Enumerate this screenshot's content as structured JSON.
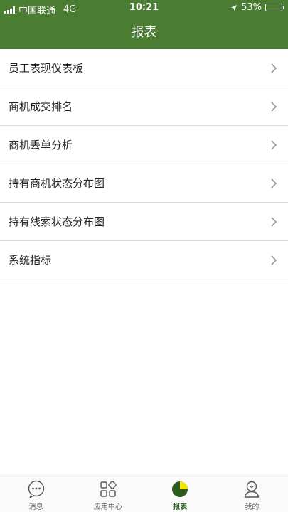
{
  "status_bar": {
    "carrier": "中国联通",
    "network": "4G",
    "time": "10:21",
    "battery_percent": "53%",
    "battery_level": 0.53
  },
  "header": {
    "title": "报表"
  },
  "report_list": [
    {
      "label": "员工表现仪表板"
    },
    {
      "label": "商机成交排名"
    },
    {
      "label": "商机丢单分析"
    },
    {
      "label": "持有商机状态分布图"
    },
    {
      "label": "持有线索状态分布图"
    },
    {
      "label": "系统指标"
    }
  ],
  "tab_bar": {
    "tabs": [
      {
        "label": "消息",
        "icon": "chat-bubble-icon"
      },
      {
        "label": "应用中心",
        "icon": "app-grid-icon"
      },
      {
        "label": "报表",
        "icon": "pie-chart-icon",
        "active": true
      },
      {
        "label": "我的",
        "icon": "person-icon"
      }
    ]
  },
  "colors": {
    "primary": "#4a7c32",
    "active_tab": "#2d5a1f",
    "pie_accent": "#f2e600"
  }
}
